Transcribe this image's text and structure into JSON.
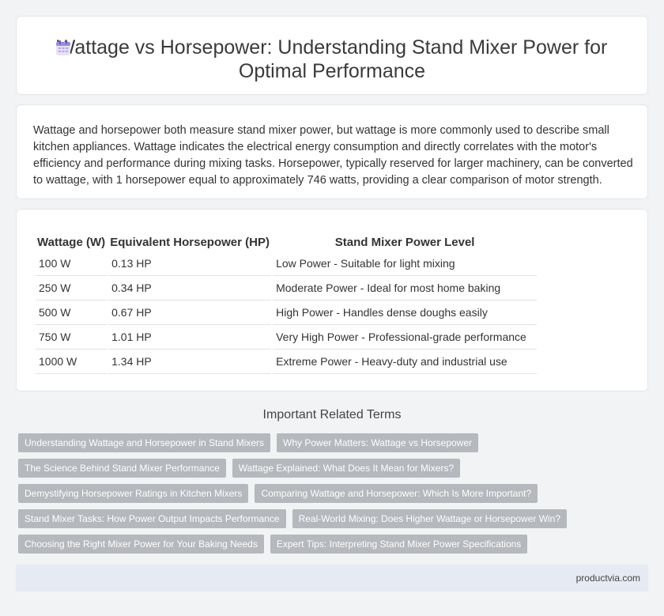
{
  "header": {
    "title": "Wattage vs Horsepower: Understanding Stand Mixer Power for Optimal Performance",
    "icon": "calendar-icon"
  },
  "intro": {
    "text": "Wattage and horsepower both measure stand mixer power, but wattage is more commonly used to describe small kitchen appliances. Wattage indicates the electrical energy consumption and directly correlates with the motor's efficiency and performance during mixing tasks. Horsepower, typically reserved for larger machinery, can be converted to wattage, with 1 horsepower equal to approximately 746 watts, providing a clear comparison of motor strength."
  },
  "table": {
    "headers": [
      "Wattage (W)",
      "Equivalent Horsepower (HP)",
      "Stand Mixer Power Level"
    ],
    "rows": [
      [
        "100 W",
        "0.13 HP",
        "Low Power - Suitable for light mixing"
      ],
      [
        "250 W",
        "0.34 HP",
        "Moderate Power - Ideal for most home baking"
      ],
      [
        "500 W",
        "0.67 HP",
        "High Power - Handles dense doughs easily"
      ],
      [
        "750 W",
        "1.01 HP",
        "Very High Power - Professional-grade performance"
      ],
      [
        "1000 W",
        "1.34 HP",
        "Extreme Power - Heavy-duty and industrial use"
      ]
    ]
  },
  "terms": {
    "title": "Important Related Terms",
    "rows": [
      [
        "Understanding Wattage and Horsepower in Stand Mixers",
        "Why Power Matters: Wattage vs Horsepower"
      ],
      [
        "The Science Behind Stand Mixer Performance",
        "Wattage Explained: What Does It Mean for Mixers?"
      ],
      [
        "Demystifying Horsepower Ratings in Kitchen Mixers",
        "Comparing Wattage and Horsepower: Which Is More Important?"
      ],
      [
        "Stand Mixer Tasks: How Power Output Impacts Performance",
        "Real-World Mixing: Does Higher Wattage or Horsepower Win?"
      ],
      [
        "Choosing the Right Mixer Power for Your Baking Needs",
        "Expert Tips: Interpreting Stand Mixer Power Specifications"
      ]
    ]
  },
  "footer": {
    "site": "productvia.com"
  },
  "colors": {
    "tag_bg": "#b5b8bd",
    "footer_bg": "#e6eaf3"
  }
}
